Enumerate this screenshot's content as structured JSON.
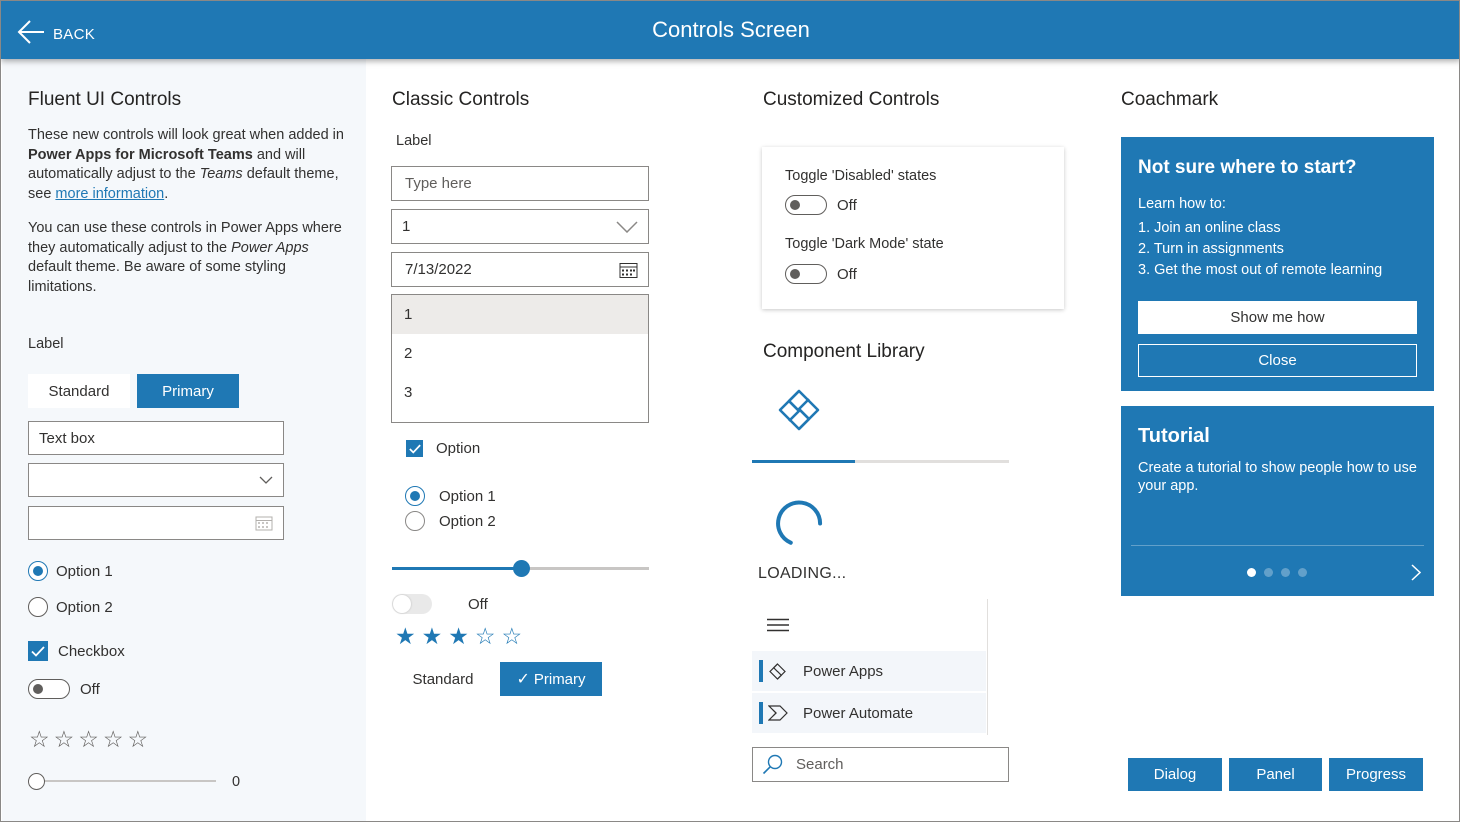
{
  "header": {
    "back_label": "BACK",
    "title": "Controls Screen"
  },
  "fluent": {
    "heading": "Fluent UI Controls",
    "para1": {
      "t1": "These new controls will look great when added in ",
      "b1": "Power Apps for Microsoft Teams",
      "t2": " and will automatically adjust to the ",
      "i1": "Teams",
      "t3": " default theme, see ",
      "link": "more information",
      "t4": "."
    },
    "para2": {
      "t1": "You can use these controls in Power Apps where they automatically adjust to the ",
      "i1": "Power Apps",
      "t2": " default theme. Be aware of some styling limitations."
    },
    "label": "Label",
    "seg_standard": "Standard",
    "seg_primary": "Primary",
    "textbox_value": "Text box",
    "radio1": "Option 1",
    "radio2": "Option 2",
    "checkbox": "Checkbox",
    "toggle_text": "Off",
    "rating": 0,
    "slider_value": "0"
  },
  "classic": {
    "heading": "Classic Controls",
    "label": "Label",
    "input_placeholder": "Type here",
    "dropdown_value": "1",
    "date_value": "7/13/2022",
    "list_items": [
      "1",
      "2",
      "3"
    ],
    "checkbox": "Option",
    "radio1": "Option 1",
    "radio2": "Option 2",
    "slider_fraction": 0.5,
    "toggle_text": "Off",
    "rating": 3,
    "btn_standard": "Standard",
    "btn_primary": "Primary"
  },
  "custom": {
    "heading": "Customized Controls",
    "toggle1_label": "Toggle 'Disabled' states",
    "toggle1_text": "Off",
    "toggle2_label": "Toggle 'Dark Mode' state",
    "toggle2_text": "Off"
  },
  "library": {
    "heading": "Component Library",
    "loading": "LOADING...",
    "nav_items": [
      "Power Apps",
      "Power Automate"
    ],
    "search_placeholder": "Search"
  },
  "coachmark": {
    "heading": "Coachmark",
    "title": "Not sure where to start?",
    "intro": "Learn how to:",
    "items": [
      "1. Join an online class",
      "2. Turn in assignments",
      "3. Get the most out of remote learning"
    ],
    "btn_show": "Show me how",
    "btn_close": "Close",
    "tutorial_title": "Tutorial",
    "tutorial_text": "Create a tutorial to show people how to use your app."
  },
  "bottom_buttons": [
    "Dialog",
    "Panel",
    "Progress"
  ],
  "colors": {
    "accent": "#1f78b4",
    "panel_bg": "#f5f8fb"
  }
}
